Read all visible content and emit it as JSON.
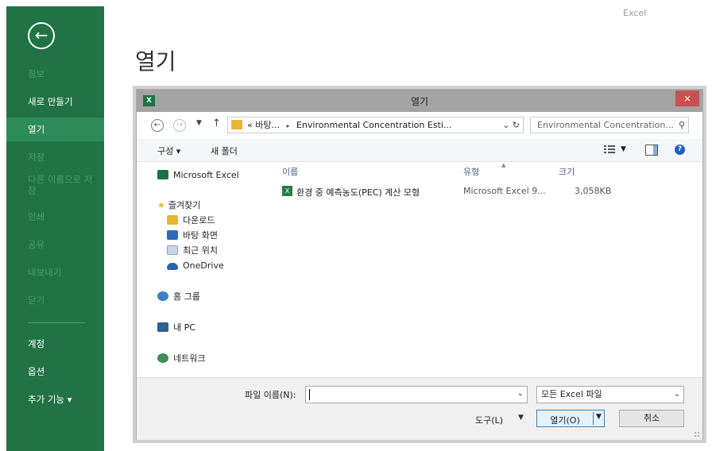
{
  "app": {
    "title": "Excel",
    "page_title": "열기"
  },
  "sidebar": {
    "back_icon": "back-arrow-icon",
    "items": [
      {
        "label": "정보",
        "state": "disabled"
      },
      {
        "label": "새로 만들기",
        "state": "normal"
      },
      {
        "label": "열기",
        "state": "selected"
      },
      {
        "label": "저장",
        "state": "disabled"
      },
      {
        "label": "다른 이름으로 저장",
        "state": "disabled"
      },
      {
        "label": "인쇄",
        "state": "disabled"
      },
      {
        "label": "공유",
        "state": "disabled"
      },
      {
        "label": "내보내기",
        "state": "disabled"
      },
      {
        "label": "닫기",
        "state": "disabled"
      },
      {
        "label": "계정",
        "state": "normal"
      },
      {
        "label": "옵션",
        "state": "normal"
      },
      {
        "label": "추가 기능 ▾",
        "state": "normal"
      }
    ],
    "colors": {
      "background": "#217346",
      "selected": "#2e8b5a",
      "disabled_text": "#4f9c6f"
    }
  },
  "dialog": {
    "title": "열기",
    "close_label": "×",
    "address": {
      "back_icon": "back-icon",
      "forward_icon": "forward-icon",
      "recent_icon": "chevron-down-icon",
      "up_icon": "up-arrow-icon",
      "prefix": "«",
      "crumb1": "바탕...",
      "separator": "▸",
      "crumb2": "Environmental Concentration Esti...",
      "tail": "⌄ ↻"
    },
    "search": {
      "placeholder": "Environmental Concentration...",
      "icon": "search-icon"
    },
    "toolbar": {
      "organize": "구성 ▾",
      "new_folder": "새 폴더",
      "view_icon": "view-options-icon",
      "preview_icon": "preview-pane-icon",
      "help_icon": "help-icon"
    },
    "nav_pane": {
      "microsoft_excel": "Microsoft Excel",
      "favorites": "즐겨찾기",
      "downloads": "다운로드",
      "desktop": "바탕 화면",
      "recent": "최근 위치",
      "onedrive": "OneDrive",
      "homegroup": "홈 그룹",
      "this_pc": "내 PC",
      "network": "네트워크"
    },
    "columns": {
      "name": "이름",
      "type": "유형",
      "size": "크기"
    },
    "files": [
      {
        "name": "환경 중 예측농도(PEC) 계산 모형",
        "type": "Microsoft Excel 9...",
        "size": "3,058KB",
        "icon": "excel-file-icon"
      }
    ],
    "bottom": {
      "filename_label": "파일 이름(N):",
      "filename_value": "",
      "filter_value": "모든 Excel 파일",
      "tools_label": "도구(L)",
      "tools_arrow": "▼",
      "open_label": "열기(O)",
      "open_drop": "▼",
      "cancel_label": "취소"
    }
  }
}
